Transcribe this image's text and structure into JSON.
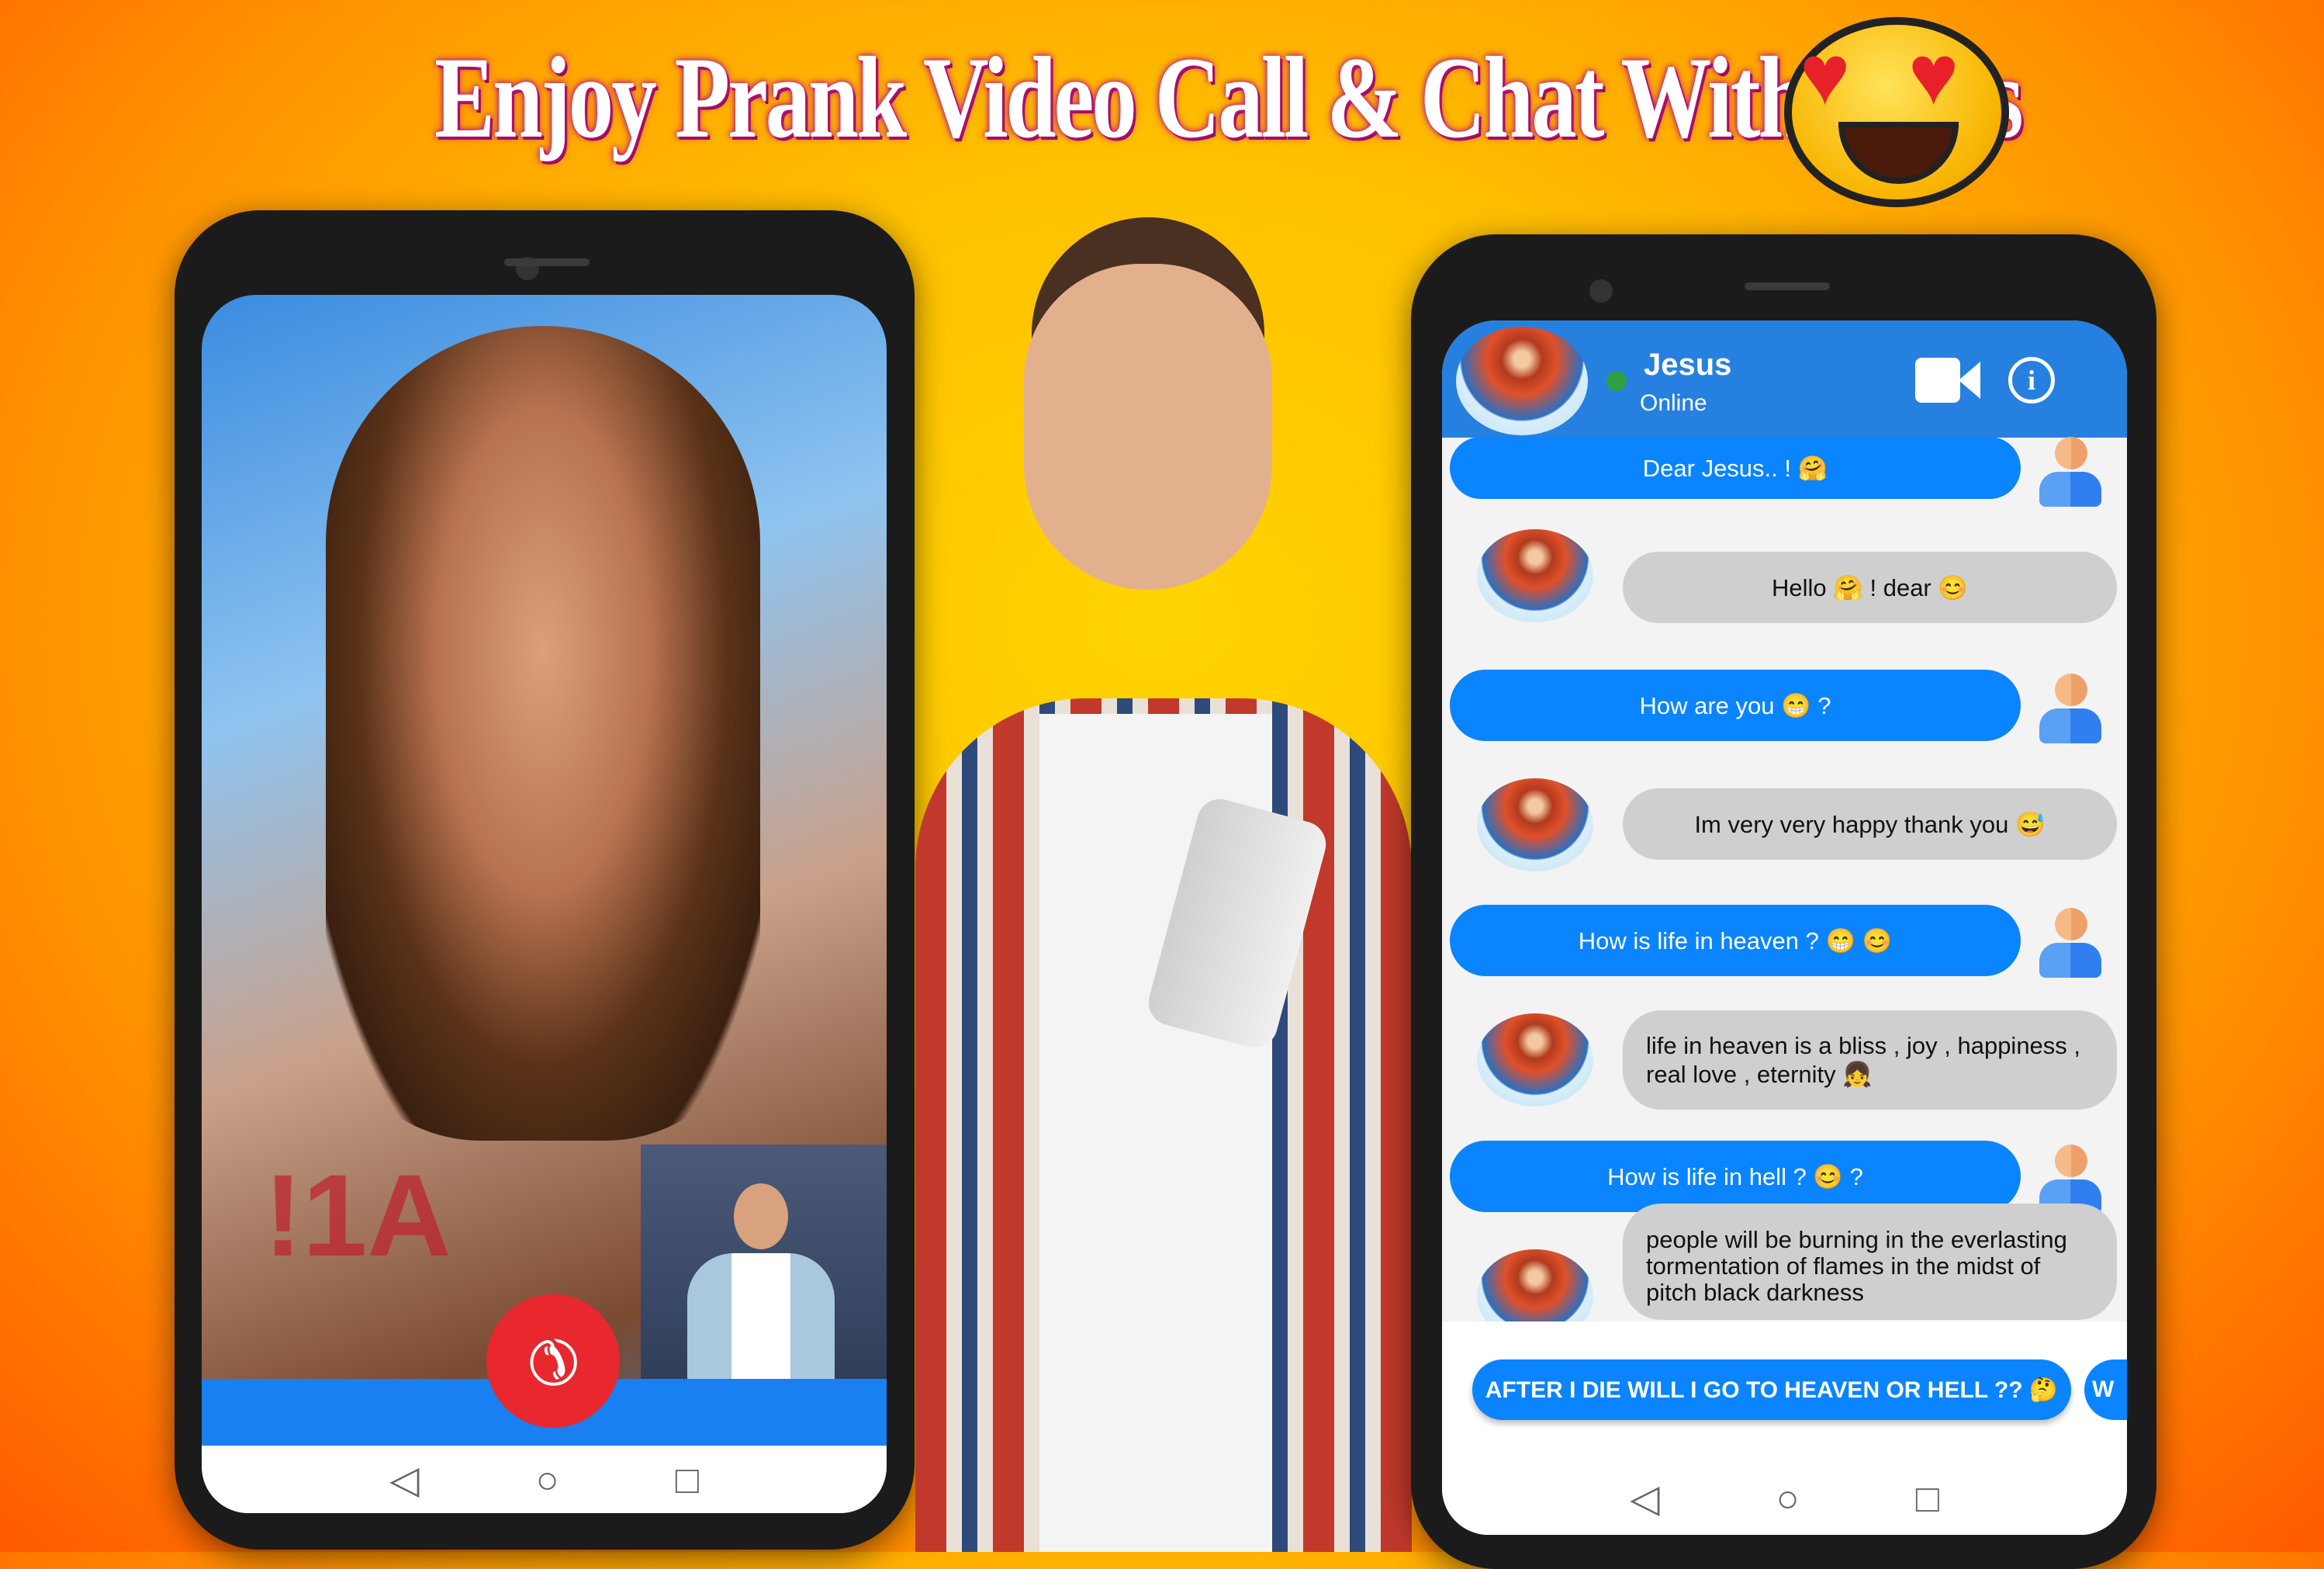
{
  "headline": "Enjoy Prank Video Call & Chat With Jesus",
  "colors": {
    "accent": "#0a84ff",
    "header": "#2680e0",
    "online": "#2ea043",
    "end_call": "#e8282e"
  },
  "video_call": {
    "end_call_icon": "phone-hangup-icon",
    "overlay_text": "!1A"
  },
  "chat": {
    "contact_name": "Jesus",
    "status": "Online",
    "header_icons": [
      "video-camera-icon",
      "info-icon"
    ],
    "messages": [
      {
        "from": "user",
        "text": "Dear Jesus.. ! 🤗"
      },
      {
        "from": "bot",
        "text": "Hello 🤗 ! dear 😊"
      },
      {
        "from": "user",
        "text": "How are you 😁 ?"
      },
      {
        "from": "bot",
        "text": "Im very very happy thank you 😅"
      },
      {
        "from": "user",
        "text": "How is life in heaven ? 😁 😊"
      },
      {
        "from": "bot",
        "text": "life in heaven is a bliss , joy , happiness , real love , eternity 👧"
      },
      {
        "from": "user",
        "text": "How is life in hell ? 😊 ?"
      },
      {
        "from": "bot",
        "text": "people will be burning in the everlasting tormentation of flames in the midst of pitch black darkness"
      }
    ],
    "suggestions": [
      "AFTER I DIE WILL I GO TO HEAVEN OR HELL ?? 🤔",
      "W"
    ]
  },
  "nav": {
    "back": "◁",
    "home": "○",
    "recents": "□"
  }
}
